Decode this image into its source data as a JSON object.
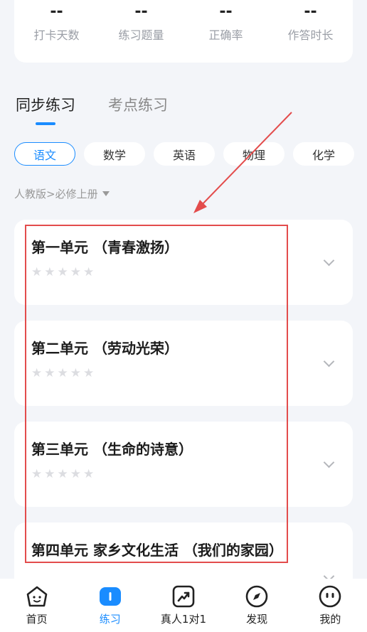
{
  "stats": [
    {
      "value": "--",
      "label": "打卡天数"
    },
    {
      "value": "--",
      "label": "练习题量"
    },
    {
      "value": "--",
      "label": "正确率"
    },
    {
      "value": "--",
      "label": "作答时长"
    }
  ],
  "main_tabs": [
    {
      "label": "同步练习",
      "active": true
    },
    {
      "label": "考点练习",
      "active": false
    }
  ],
  "subjects": [
    {
      "label": "语文",
      "active": true
    },
    {
      "label": "数学"
    },
    {
      "label": "英语"
    },
    {
      "label": "物理"
    },
    {
      "label": "化学"
    }
  ],
  "edition": {
    "label": "人教版>必修上册"
  },
  "units": [
    {
      "title": "第一单元 （青春激扬）",
      "stars": 0
    },
    {
      "title": "第二单元 （劳动光荣）",
      "stars": 0
    },
    {
      "title": "第三单元 （生命的诗意）",
      "stars": 0
    },
    {
      "title": "第四单元 家乡文化生活 （我们的家园）",
      "stars": 0
    }
  ],
  "nav": [
    {
      "label": "首页",
      "icon": "home-face-icon"
    },
    {
      "label": "练习",
      "icon": "practice-icon",
      "active": true
    },
    {
      "label": "真人1对1",
      "icon": "trend-icon"
    },
    {
      "label": "发现",
      "icon": "compass-icon"
    },
    {
      "label": "我的",
      "icon": "profile-face-icon"
    }
  ],
  "colors": {
    "accent": "#1a8cff",
    "annotation": "#e34c4c",
    "background": "#f3f5f9"
  }
}
